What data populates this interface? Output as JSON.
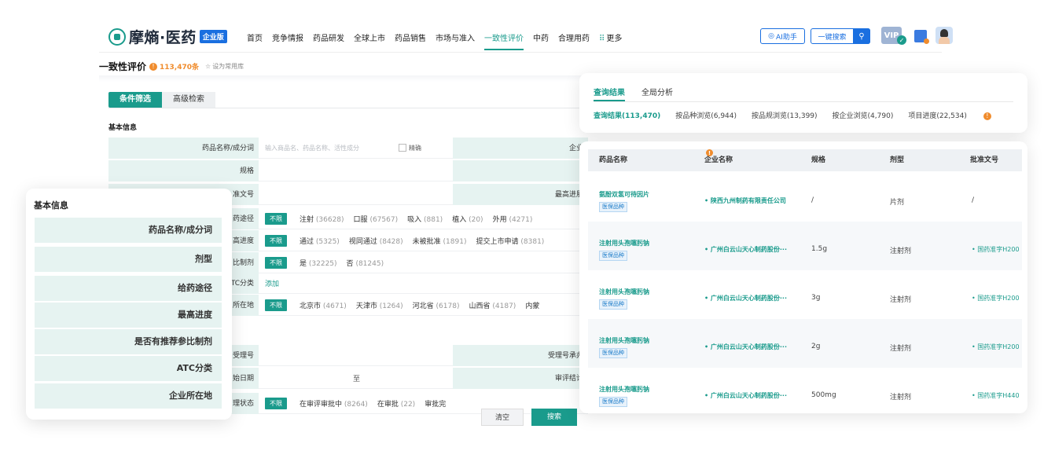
{
  "brand": {
    "name": "摩熵·医药",
    "badge": "企业版"
  },
  "nav": [
    "首页",
    "竞争情报",
    "药品研发",
    "全球上市",
    "药品销售",
    "市场与准入",
    "一致性评价",
    "中药",
    "合理用药",
    "更多"
  ],
  "nav_active_index": 6,
  "header_actions": {
    "ai": "AI助手",
    "search": "一键搜索",
    "vip": "VIP"
  },
  "page": {
    "title": "一致性评价",
    "count": "113,470条",
    "favorite": "设为常用库"
  },
  "filter": {
    "tab_active": "条件筛选",
    "tab_other": "高级检索",
    "section_basic": "基本信息",
    "drug_name_label": "药品名称/成分词",
    "drug_name_placeholder": "输入商品名、药品名称、活性成分",
    "exact": "精确",
    "company_label": "企业",
    "spec_label": "规格",
    "approval_label": "准文号",
    "highest_label": "最高进展",
    "route_label": "药途径",
    "progress_label": "高进度",
    "ref_label": "比制剂",
    "atc_label": "TC分类",
    "location_label": "所在地",
    "accept_label": "受理号",
    "accept_promise_label": "受理号承办",
    "start_date_label": "始日期",
    "review_result_label": "审评结论",
    "status_label": "理状态",
    "unlimited": "不限",
    "add": "添加",
    "to": "至",
    "route_opts": [
      [
        "注射",
        "(36628)"
      ],
      [
        "口服",
        "(67567)"
      ],
      [
        "吸入",
        "(881)"
      ],
      [
        "植入",
        "(20)"
      ],
      [
        "外用",
        "(4271)"
      ]
    ],
    "progress_opts": [
      [
        "通过",
        "(5325)"
      ],
      [
        "视同通过",
        "(8428)"
      ],
      [
        "未被批准",
        "(1891)"
      ],
      [
        "提交上市申请",
        "(8381)"
      ]
    ],
    "ref_opts": [
      [
        "是",
        "(32225)"
      ],
      [
        "否",
        "(81245)"
      ]
    ],
    "location_opts": [
      [
        "北京市",
        "(4671)"
      ],
      [
        "天津市",
        "(1264)"
      ],
      [
        "河北省",
        "(6178)"
      ],
      [
        "山西省",
        "(4187)"
      ],
      [
        "内蒙",
        ""
      ]
    ],
    "status_opts": [
      [
        "在审评审批中",
        "(8264)"
      ],
      [
        "在审批",
        "(22)"
      ],
      [
        "审批完",
        ""
      ]
    ],
    "clear": "清空",
    "search": "搜索"
  },
  "left_card": {
    "title": "基本信息",
    "rows": [
      "药品名称/成分词",
      "剂型",
      "给药途径",
      "最高进度",
      "是否有推荐参比制剂",
      "ATC分类",
      "企业所在地"
    ]
  },
  "results": {
    "tabs": [
      "查询结果",
      "全局分析"
    ],
    "stats": [
      "查询结果(113,470)",
      "按品种浏览(6,944)",
      "按品规浏览(13,399)",
      "按企业浏览(4,790)",
      "项目进度(22,534)"
    ],
    "columns": [
      "药品名称",
      "企业名称",
      "规格",
      "剂型",
      "批准文号"
    ],
    "rows": [
      {
        "name": "氨酚双氢可待因片",
        "tag": "医保品种",
        "company": "• 陕西九州制药有限责任公司",
        "spec": "/",
        "form": "片剂",
        "approval": "/"
      },
      {
        "name": "注射用头孢噻肟钠",
        "tag": "医保品种",
        "company": "• 广州白云山天心制药股份···",
        "spec": "1.5g",
        "form": "注射剂",
        "approval": "• 国药准字H200"
      },
      {
        "name": "注射用头孢噻肟钠",
        "tag": "医保品种",
        "company": "• 广州白云山天心制药股份···",
        "spec": "3g",
        "form": "注射剂",
        "approval": "• 国药准字H200"
      },
      {
        "name": "注射用头孢噻肟钠",
        "tag": "医保品种",
        "company": "• 广州白云山天心制药股份···",
        "spec": "2g",
        "form": "注射剂",
        "approval": "• 国药准字H200"
      },
      {
        "name": "注射用头孢噻肟钠",
        "tag": "医保品种",
        "company": "• 广州白云山天心制药股份···",
        "spec": "500mg",
        "form": "注射剂",
        "approval": "• 国药准字H440"
      }
    ]
  },
  "colors": {
    "primary": "#1a9b8c",
    "blue": "#1a6fe0",
    "warn": "#f08c2d",
    "label_bg": "#e6f3f1"
  }
}
